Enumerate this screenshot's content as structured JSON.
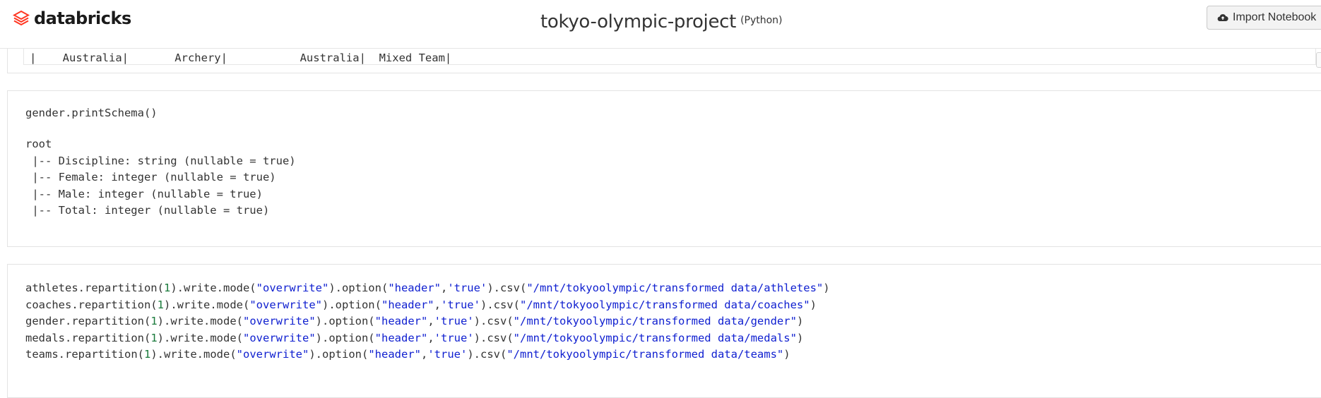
{
  "header": {
    "logo_text": "databricks",
    "notebook_title": "tokyo-olympic-project",
    "language": "(Python)",
    "import_button_label": "Import Notebook"
  },
  "cell_prev_output": {
    "line_partial": "|             |             |                    |             |",
    "line": "|    Australia|       Archery|           Australia|  Mixed Team|"
  },
  "cell_schema": {
    "code": "gender.printSchema()",
    "output_lines": [
      "root",
      " |-- Discipline: string (nullable = true)",
      " |-- Female: integer (nullable = true)",
      " |-- Male: integer (nullable = true)",
      " |-- Total: integer (nullable = true)"
    ]
  },
  "cell_write": {
    "lines": [
      {
        "var": "athletes",
        "num": "1",
        "mode": "\"overwrite\"",
        "key": "\"header\"",
        "val": "'true'",
        "path": "\"/mnt/tokyoolympic/transformed data/athletes\""
      },
      {
        "var": "coaches",
        "num": "1",
        "mode": "\"overwrite\"",
        "key": "\"header\"",
        "val": "'true'",
        "path": "\"/mnt/tokyoolympic/transformed data/coaches\""
      },
      {
        "var": "gender",
        "num": "1",
        "mode": "\"overwrite\"",
        "key": "\"header\"",
        "val": "'true'",
        "path": "\"/mnt/tokyoolympic/transformed data/gender\""
      },
      {
        "var": "medals",
        "num": "1",
        "mode": "\"overwrite\"",
        "key": "\"header\"",
        "val": "'true'",
        "path": "\"/mnt/tokyoolympic/transformed data/medals\""
      },
      {
        "var": "teams",
        "num": "1",
        "mode": "\"overwrite\"",
        "key": "\"header\"",
        "val": "'true'",
        "path": "\"/mnt/tokyoolympic/transformed data/teams\""
      }
    ]
  },
  "icons": {
    "logo": "databricks-logo-icon",
    "import": "cloud-upload-icon",
    "resize": "resize-handle-icon"
  },
  "colors": {
    "string": "#1020d0",
    "number": "#1a7a3c",
    "brand": "#ff3621"
  }
}
